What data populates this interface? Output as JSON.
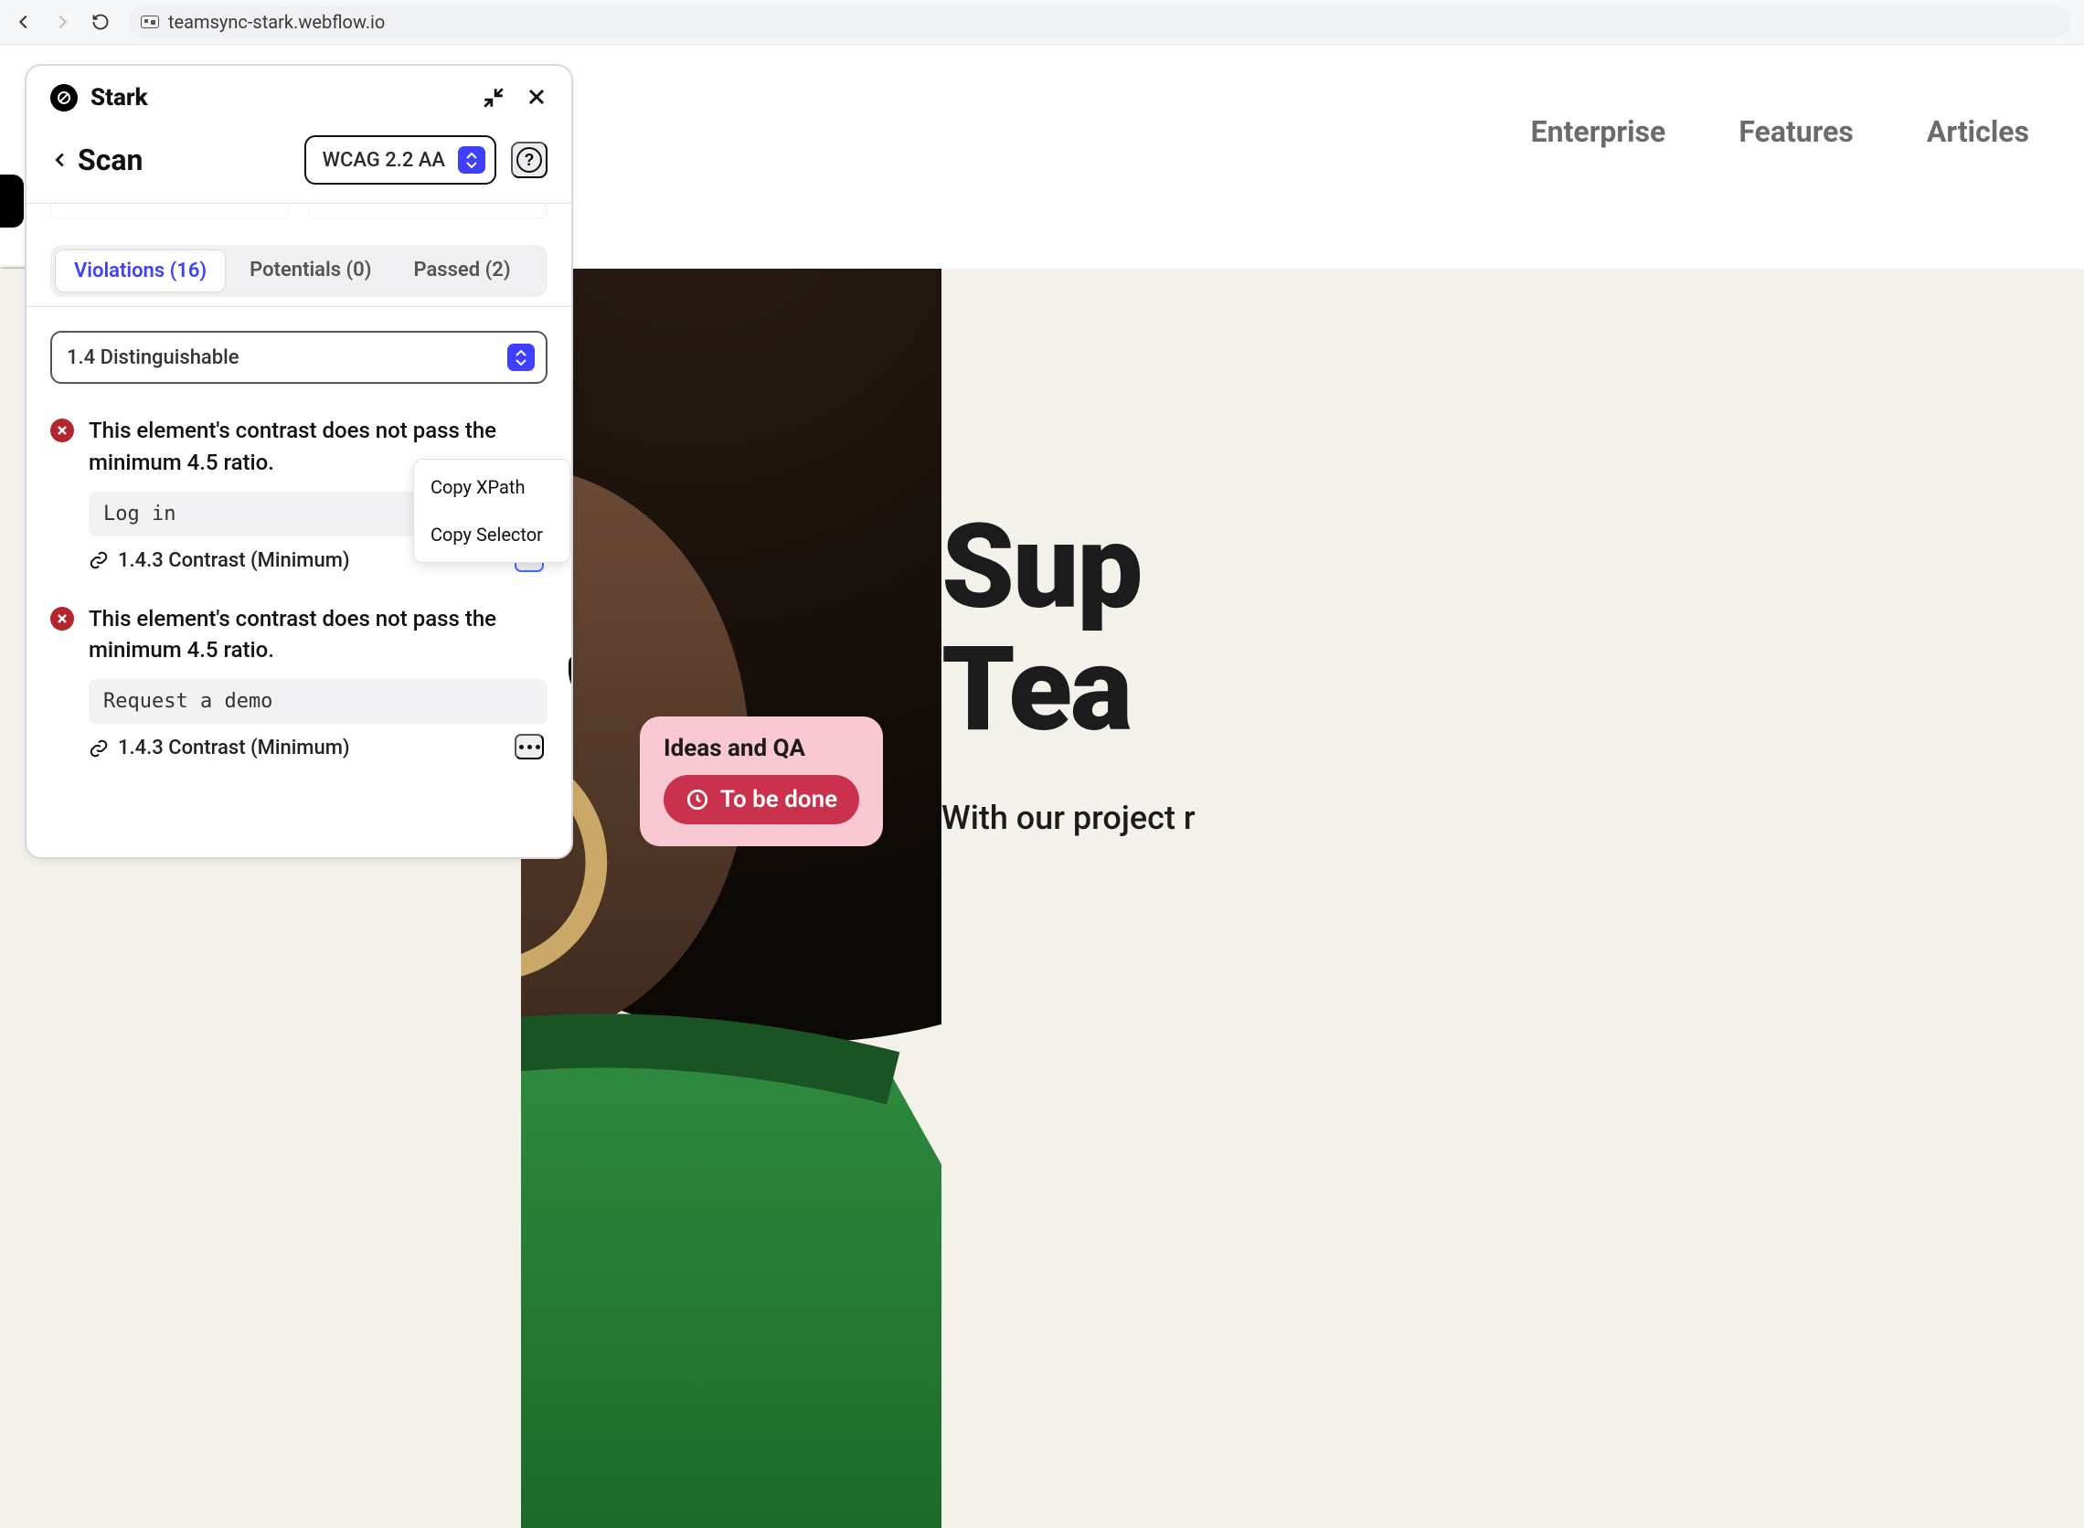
{
  "browser": {
    "url": "teamsync-stark.webflow.io"
  },
  "site_nav": {
    "items": [
      "Enterprise",
      "Features",
      "Articles"
    ]
  },
  "hero": {
    "title_lines": [
      "Sup",
      "Tea"
    ],
    "subtitle": "With our project r"
  },
  "badge": {
    "title": "Ideas and QA",
    "pill": "To be done"
  },
  "panel": {
    "brand": "Stark",
    "back_label": "Scan",
    "wcag_label": "WCAG 2.2 AA",
    "tabs": {
      "violations": {
        "label": "Violations",
        "count": 16
      },
      "potentials": {
        "label": "Potentials",
        "count": 0
      },
      "passed": {
        "label": "Passed",
        "count": 2
      }
    },
    "category": "1.4 Distinguishable",
    "violations": [
      {
        "message": "This element's contrast does not pass the minimum 4.5 ratio.",
        "code": "Log in",
        "ref": "1.4.3 Contrast (Minimum)"
      },
      {
        "message": "This element's contrast does not pass the minimum 4.5 ratio.",
        "code": "Request a demo",
        "ref": "1.4.3 Contrast (Minimum)"
      }
    ],
    "context_menu": {
      "copy_xpath": "Copy XPath",
      "copy_selector": "Copy Selector"
    }
  }
}
